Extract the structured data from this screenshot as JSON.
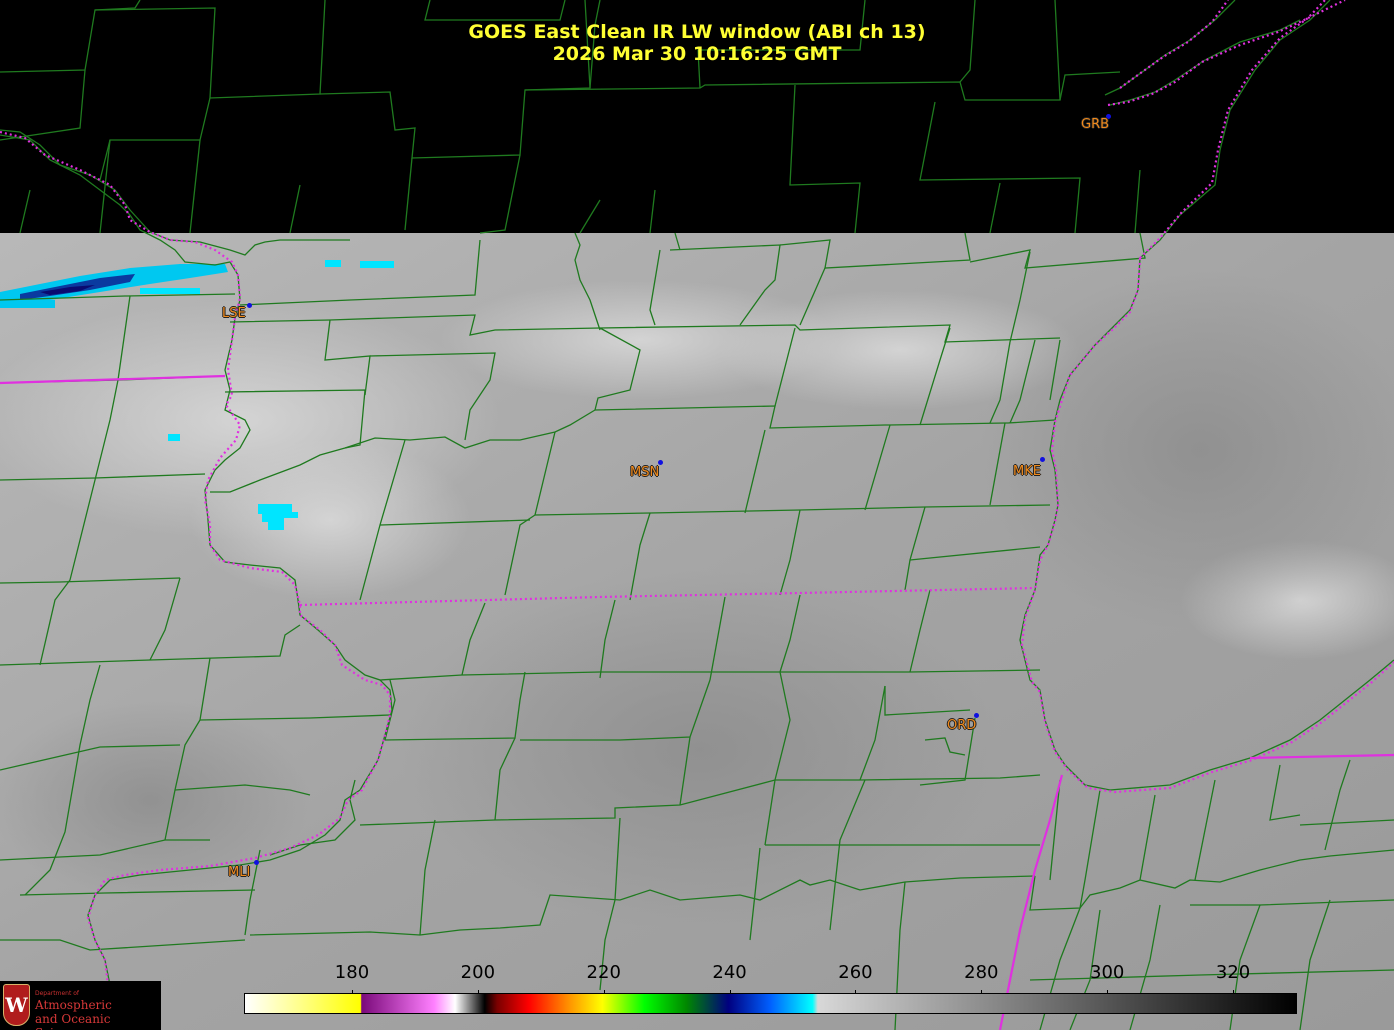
{
  "title": {
    "line1": "GOES East Clean IR LW window (ABI ch 13)",
    "line2": "2026 Mar 30  10:16:25 GMT"
  },
  "stations": [
    {
      "id": "GRB",
      "label": "GRB"
    },
    {
      "id": "LSE",
      "label": "LSE"
    },
    {
      "id": "MSN",
      "label": "MSN"
    },
    {
      "id": "MKE",
      "label": "MKE"
    },
    {
      "id": "ORD",
      "label": "ORD"
    },
    {
      "id": "MLI",
      "label": "MLI"
    }
  ],
  "colorbar": {
    "min_value": 163,
    "max_value": 330,
    "ticks": [
      "180",
      "200",
      "220",
      "240",
      "260",
      "280",
      "300",
      "320"
    ],
    "tick_values": [
      180,
      200,
      220,
      240,
      260,
      280,
      300,
      320
    ]
  },
  "logo": {
    "shield_letter": "W",
    "dept": "Department of",
    "line1": "Atmospheric",
    "line2": "and Oceanic Sciences"
  },
  "colors": {
    "title": "#ffff33",
    "county_lines": "#1f7a1f",
    "state_borders": "#e030e0",
    "station_label": "#f08a1c",
    "station_dot": "#1010e0",
    "cold_cloud": "#00e5ff"
  }
}
